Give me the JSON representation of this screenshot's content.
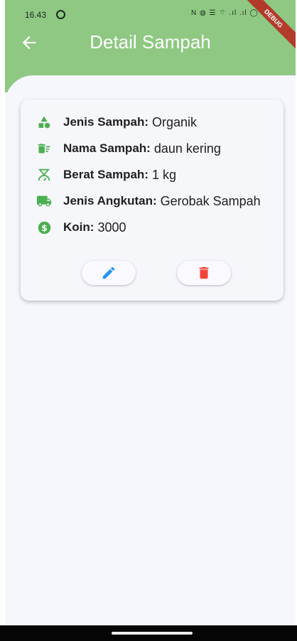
{
  "status_bar": {
    "time": "16.43",
    "icons_text": "N ◍ ☰ ⌔ .ıl .ıl ◯ 100"
  },
  "debug_banner": "DEBUG",
  "app_bar": {
    "title": "Detail Sampah",
    "back_icon": "arrow-left-icon"
  },
  "details": [
    {
      "icon": "shapes-icon",
      "label": "Jenis Sampah:",
      "value": "Organik"
    },
    {
      "icon": "delete-sweep-icon",
      "label": "Nama Sampah:",
      "value": "daun kering"
    },
    {
      "icon": "scale-icon",
      "label": "Berat Sampah:",
      "value": "1 kg"
    },
    {
      "icon": "truck-icon",
      "label": "Jenis Angkutan:",
      "value": "Gerobak Sampah"
    },
    {
      "icon": "dollar-coin-icon",
      "label": "Koin:",
      "value": "3000"
    }
  ],
  "actions": {
    "edit_icon": "pencil-icon",
    "delete_icon": "trash-icon"
  },
  "colors": {
    "appbar": "#8ec882",
    "icon_green": "#4caf50",
    "edit_blue": "#2196f3",
    "delete_red": "#f44336"
  }
}
